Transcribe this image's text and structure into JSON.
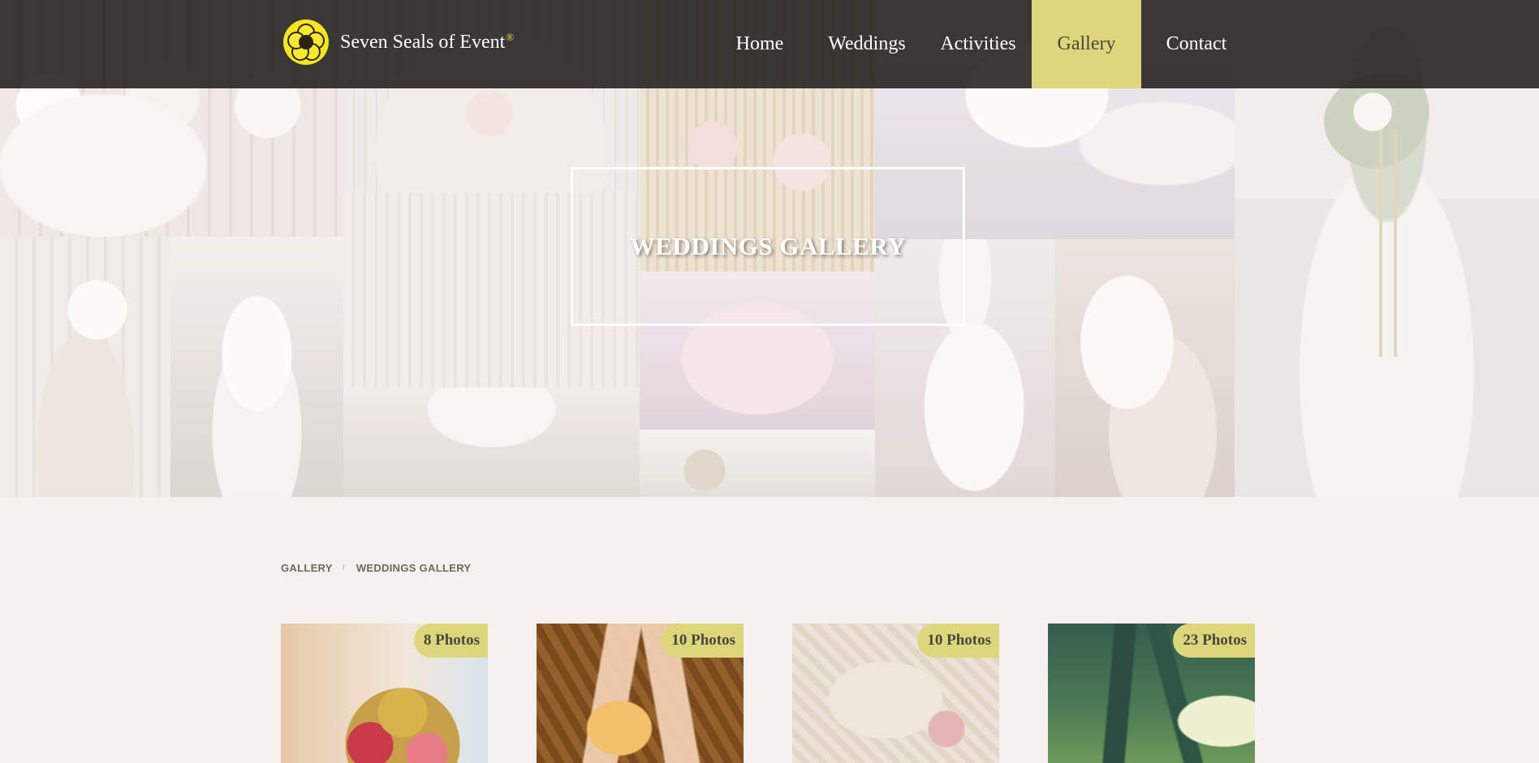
{
  "brand": {
    "name": "Seven Seals of Event",
    "reg_mark": "®"
  },
  "nav": {
    "items": [
      {
        "label": "Home"
      },
      {
        "label": "Weddings"
      },
      {
        "label": "Activities"
      },
      {
        "label": "Gallery",
        "active": true
      },
      {
        "label": "Contact"
      }
    ]
  },
  "hero": {
    "title": "WEDDINGS GALLERY"
  },
  "breadcrumb": {
    "items": [
      "GALLERY",
      "WEDDINGS GALLERY"
    ],
    "separator": "/"
  },
  "albums": [
    {
      "count_label": "8 Photos"
    },
    {
      "count_label": "10 Photos"
    },
    {
      "count_label": "10 Photos"
    },
    {
      "count_label": "23 Photos"
    }
  ],
  "colors": {
    "accent": "#ddd67a",
    "nav_bg": "#211e1c",
    "logo_yellow": "#f5e61f",
    "page_bg": "#f6f1ee"
  }
}
